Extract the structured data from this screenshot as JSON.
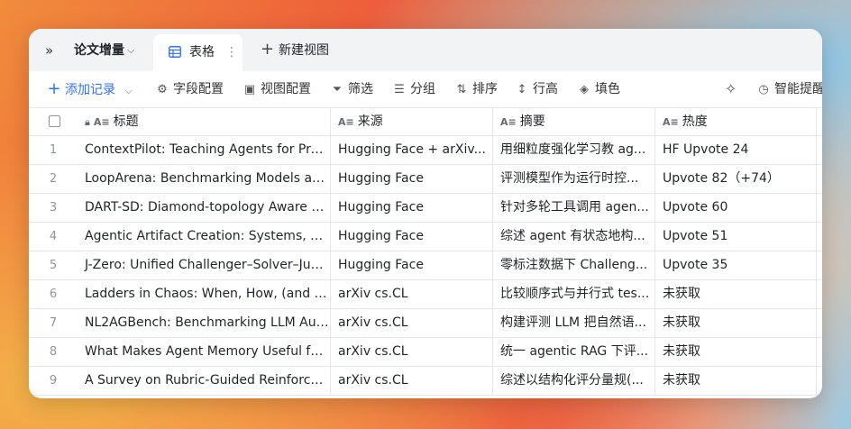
{
  "tabbar": {
    "base_name": "论文增量",
    "active_tab": "表格",
    "new_view": "新建视图"
  },
  "toolbar": {
    "add_record": "添加记录",
    "field_config": "字段配置",
    "view_config": "视图配置",
    "filter": "筛选",
    "group": "分组",
    "sort": "排序",
    "row_height": "行高",
    "fill": "填色",
    "smart": "智能提醒"
  },
  "columns": {
    "title": "标题",
    "source": "来源",
    "abstract": "摘要",
    "heat": "热度"
  },
  "rows": [
    {
      "num": "1",
      "title": "ContextPilot: Teaching Agents for Proa...",
      "source": "Hugging Face + arXiv...",
      "abstract": "用细粒度强化学习教 ag...",
      "heat": "HF Upvote 24"
    },
    {
      "num": "2",
      "title": "LoopArena: Benchmarking Models as ...",
      "source": "Hugging Face",
      "abstract": "评测模型作为运行时控...",
      "heat": "Upvote 82（+74）"
    },
    {
      "num": "3",
      "title": "DART-SD: Diamond-topology Aware R...",
      "source": "Hugging Face",
      "abstract": "针对多轮工具调用 agen...",
      "heat": "Upvote 60"
    },
    {
      "num": "4",
      "title": "Agentic Artifact Creation: Systems, Ev...",
      "source": "Hugging Face",
      "abstract": "综述 agent 有状态地构...",
      "heat": "Upvote 51"
    },
    {
      "num": "5",
      "title": "J-Zero: Unified Challenger–Solver–Jud...",
      "source": "Hugging Face",
      "abstract": "零标注数据下 Challeng...",
      "heat": "Upvote 35"
    },
    {
      "num": "6",
      "title": "Ladders in Chaos: When, How, (and Pe...",
      "source": "arXiv cs.CL",
      "abstract": "比较顺序式与并行式 tes...",
      "heat": "未获取"
    },
    {
      "num": "7",
      "title": "NL2AGBench: Benchmarking LLM Auto...",
      "source": "arXiv cs.CL",
      "abstract": "构建评测 LLM 把自然语...",
      "heat": "未获取"
    },
    {
      "num": "8",
      "title": "What Makes Agent Memory Useful for ...",
      "source": "arXiv cs.CL",
      "abstract": "统一 agentic RAG 下评...",
      "heat": "未获取"
    },
    {
      "num": "9",
      "title": "A Survey on Rubric-Guided Reinforce...",
      "source": "arXiv cs.CL",
      "abstract": "综述以结构化评分量规(...",
      "heat": "未获取"
    }
  ]
}
